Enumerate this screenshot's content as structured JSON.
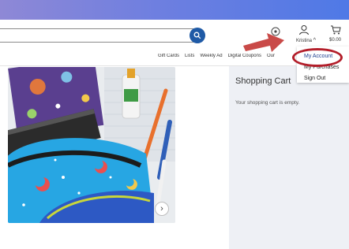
{
  "header": {
    "user_name": "Kristina",
    "user_caret": "^",
    "cart_total": "$0.00",
    "icons": {
      "search": "search-icon",
      "location": "location-pin-icon",
      "user": "user-icon",
      "cart": "cart-icon",
      "annotation": "red-arrow-icon"
    }
  },
  "nav": {
    "links": [
      "Gift Cards",
      "Lists",
      "Weekly Ad",
      "Digital Coupons",
      "Our"
    ]
  },
  "account_menu": {
    "items": [
      "My Account",
      "My Purchases",
      "Sign Out"
    ]
  },
  "hero": {
    "next_label": "›"
  },
  "cart": {
    "title": "Shopping Cart",
    "empty_message": "Your shopping cart is empty."
  },
  "colors": {
    "topbar_start": "#8e88d6",
    "topbar_end": "#4f79e6",
    "search_button": "#1f5aa6",
    "highlight_ring": "#b31e2a",
    "arrow": "#c94a48",
    "cart_panel": "#eef0f5"
  }
}
